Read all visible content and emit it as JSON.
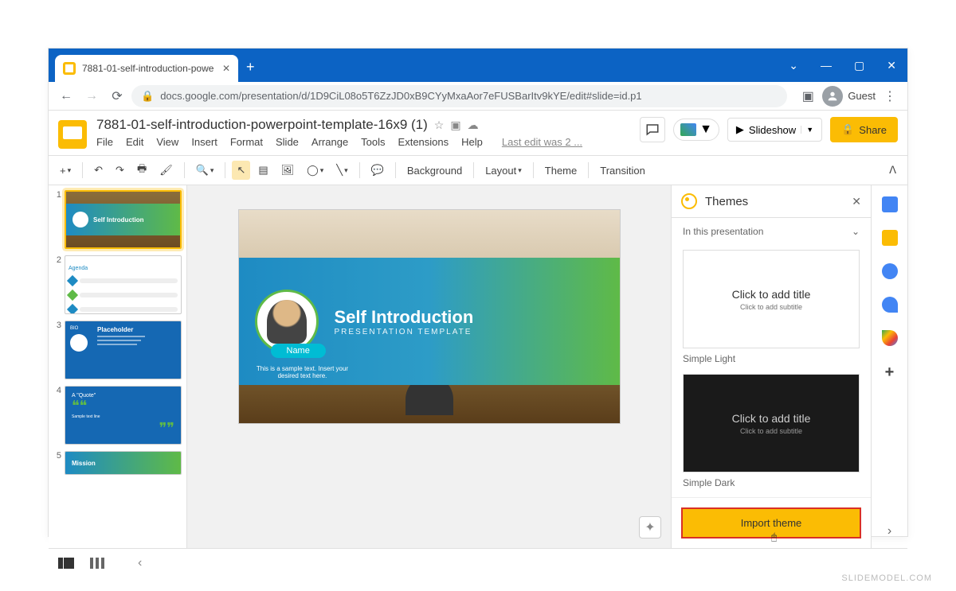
{
  "browser": {
    "tab_title": "7881-01-self-introduction-powe",
    "url": "docs.google.com/presentation/d/1D9CiL08o5T6ZzJD0xB9CYyMxaAor7eFUSBarItv9kYE/edit#slide=id.p1",
    "guest_label": "Guest"
  },
  "doc": {
    "title": "7881-01-self-introduction-powerpoint-template-16x9 (1)",
    "last_edit": "Last edit was 2 ...",
    "slideshow": "Slideshow",
    "share": "Share"
  },
  "menu": {
    "file": "File",
    "edit": "Edit",
    "view": "View",
    "insert": "Insert",
    "format": "Format",
    "slide": "Slide",
    "arrange": "Arrange",
    "tools": "Tools",
    "extensions": "Extensions",
    "help": "Help"
  },
  "toolbar": {
    "background": "Background",
    "layout": "Layout",
    "theme": "Theme",
    "transition": "Transition"
  },
  "slide": {
    "title": "Self Introduction",
    "subtitle": "PRESENTATION TEMPLATE",
    "name": "Name",
    "sample": "This is a sample text. Insert your desired text here."
  },
  "thumbs": {
    "t1": "Self Introduction",
    "t2": "Agenda",
    "t3_title": "Placeholder",
    "t3_label": "BIO",
    "t4": "A \"Quote\"",
    "t5": "Mission"
  },
  "themes": {
    "panel_title": "Themes",
    "in_presentation": "In this presentation",
    "preview_title": "Click to add title",
    "preview_sub": "Click to add subtitle",
    "simple_light": "Simple Light",
    "simple_dark": "Simple Dark",
    "import": "Import theme"
  },
  "watermark": "SLIDEMODEL.COM"
}
